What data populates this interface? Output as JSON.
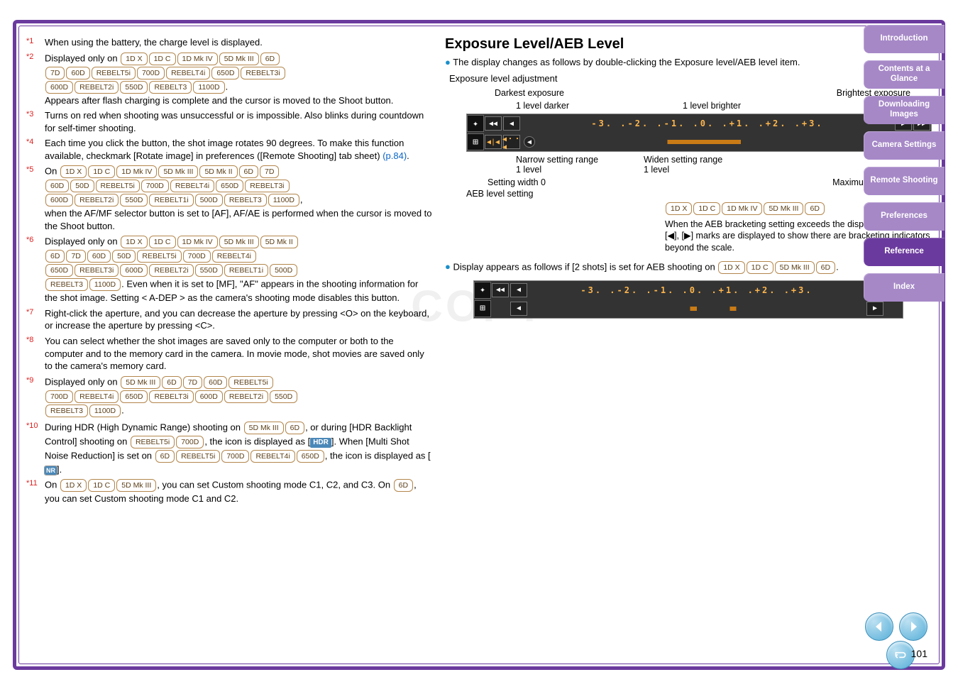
{
  "pagenum": "101",
  "sidebar": [
    {
      "label": "Introduction",
      "light": true
    },
    {
      "label": "Contents at a Glance",
      "light": true
    },
    {
      "label": "Downloading Images",
      "light": true
    },
    {
      "label": "Camera Settings",
      "light": true
    },
    {
      "label": "Remote Shooting",
      "light": true
    },
    {
      "label": "Preferences",
      "light": true
    },
    {
      "label": "Reference",
      "light": false
    },
    {
      "label": "Index",
      "light": true
    }
  ],
  "footnotes": {
    "f1": "When using the battery, the charge level is displayed.",
    "f2a": "Displayed only on ",
    "f2_badges1": [
      "1D X",
      "1D C",
      "1D Mk IV",
      "5D Mk III",
      "6D"
    ],
    "f2_badges2": [
      "7D",
      "60D",
      "REBELT5i",
      "700D",
      "REBELT4i",
      "650D",
      "REBELT3i"
    ],
    "f2_badges3": [
      "600D",
      "REBELT2i",
      "550D",
      "REBELT3",
      "1100D"
    ],
    "f2b": ".",
    "f2_after": "Appears after flash charging is complete and the cursor is moved to the Shoot button.",
    "f3": "Turns on red when shooting was unsuccessful or is impossible. Also blinks during countdown for self-timer shooting.",
    "f4a": "Each time you click the button, the shot image rotates 90 degrees. To make this function available, checkmark [Rotate image] in preferences ([Remote Shooting] tab sheet) ",
    "f4_link": "(p.84)",
    "f4b": ".",
    "f5a": "On ",
    "f5_badges1": [
      "1D X",
      "1D C",
      "1D Mk IV",
      "5D Mk III",
      "5D Mk II",
      "6D",
      "7D"
    ],
    "f5_badges2": [
      "60D",
      "50D",
      "REBELT5i",
      "700D",
      "REBELT4i",
      "650D",
      "REBELT3i"
    ],
    "f5_badges3": [
      "600D",
      "REBELT2i",
      "550D",
      "REBELT1i",
      "500D",
      "REBELT3",
      "1100D"
    ],
    "f5b": ",",
    "f5_after": "when the AF/MF selector button is set to [AF], AF/AE is performed when the cursor is moved to the Shoot button.",
    "f6a": "Displayed only on ",
    "f6_badges1": [
      "1D X",
      "1D C",
      "1D Mk IV",
      "5D Mk III",
      "5D Mk II"
    ],
    "f6_badges2": [
      "6D",
      "7D",
      "60D",
      "50D",
      "REBELT5i",
      "700D",
      "REBELT4i"
    ],
    "f6_badges3": [
      "650D",
      "REBELT3i",
      "600D",
      "REBELT2i",
      "550D",
      "REBELT1i",
      "500D"
    ],
    "f6_badges4": [
      "REBELT3",
      "1100D"
    ],
    "f6b": ". Even when it is set to [MF], \"AF\" appears in the shooting information for the shot image. Setting < A-DEP > as the camera's shooting mode disables this button.",
    "f7": "Right-click the aperture, and you can decrease the aperture by pressing <O> on the keyboard, or increase the aperture by pressing <C>.",
    "f8": "You can select whether the shot images are saved only to the computer or both to the computer and to the memory card in the camera. In movie mode, shot movies are saved only to the camera's memory card.",
    "f9a": "Displayed only on ",
    "f9_badges1": [
      "5D Mk III",
      "6D",
      "7D",
      "60D",
      "REBELT5i"
    ],
    "f9_badges2": [
      "700D",
      "REBELT4i",
      "650D",
      "REBELT3i",
      "600D",
      "REBELT2i",
      "550D"
    ],
    "f9_badges3": [
      "REBELT3",
      "1100D"
    ],
    "f9b": ".",
    "f10a": "During HDR (High Dynamic Range) shooting on ",
    "f10_badges1": [
      "5D Mk III",
      "6D"
    ],
    "f10b": ", or during [HDR Backlight Control] shooting on ",
    "f10_badges2": [
      "REBELT5i",
      "700D"
    ],
    "f10c": ", the icon is displayed as [",
    "f10_hdr": "HDR",
    "f10d": "]. When [Multi Shot Noise Reduction] is set on ",
    "f10_badges3": [
      "6D",
      "REBELT5i",
      "700D",
      "REBELT4i",
      "650D"
    ],
    "f10e": ", the icon is displayed as [",
    "f10_nr": "NR",
    "f10f": "].",
    "f11a": "On ",
    "f11_badges1": [
      "1D X",
      "1D C",
      "5D Mk III"
    ],
    "f11b": ", you can set Custom shooting mode C1, C2, and C3. On ",
    "f11_badges2": [
      "6D"
    ],
    "f11c": ", you can set Custom shooting mode C1 and C2."
  },
  "right": {
    "heading": "Exposure Level/AEB Level",
    "intro": "The display changes as follows by double-clicking the Exposure level/AEB level item.",
    "adj_title": "Exposure level adjustment",
    "darkest": "Darkest exposure",
    "brightest": "Brightest exposure",
    "darker1": "1 level darker",
    "brighter1": "1 level brighter",
    "scale_text": "-3. .-2. .-1. .0. .+1. .+2. .+3.",
    "narrow": "Narrow setting range 1 level",
    "widen": "Widen setting range 1 level",
    "width0": "Setting width 0",
    "max_range": "Maximum setting range",
    "aeb_title": "AEB level setting",
    "aeb_badges": [
      "1D X",
      "1D C",
      "1D Mk IV",
      "5D Mk III",
      "6D"
    ],
    "aeb_note": "When the AEB bracketing setting exceeds the displayable range, [◀], [▶] marks are displayed to show there are bracketing indicators beyond the scale.",
    "two_shots": "Display appears as follows if [2 shots] is set for AEB shooting on ",
    "two_shots_badges": [
      "1D X",
      "1D C",
      "5D Mk III",
      "6D"
    ],
    "two_shots_end": "."
  }
}
